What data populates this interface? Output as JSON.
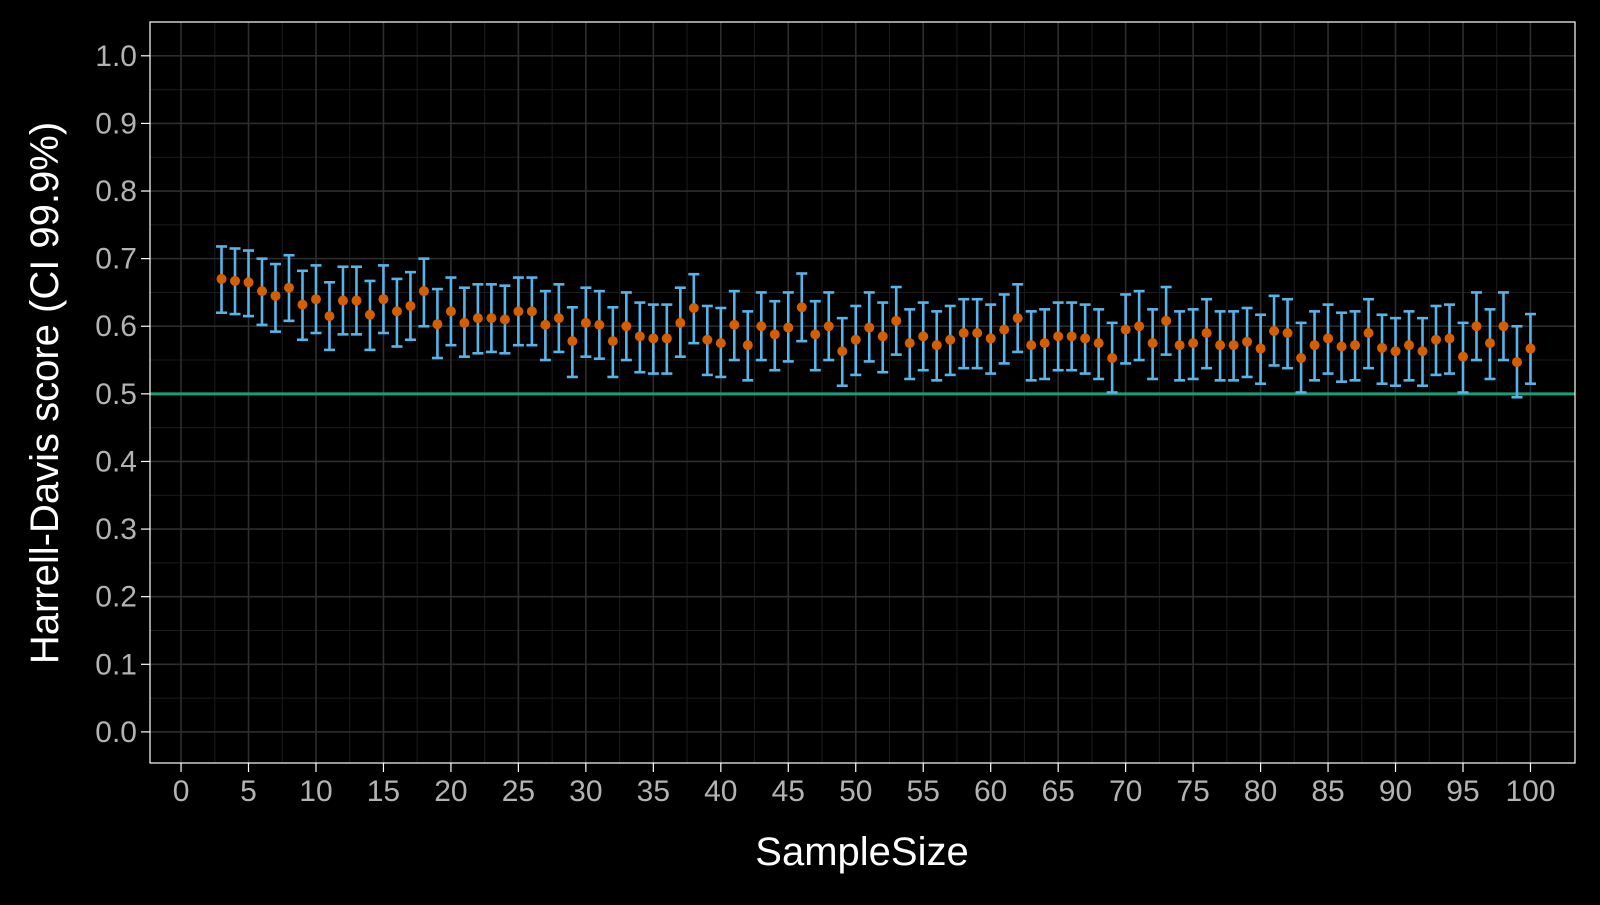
{
  "chart_data": {
    "type": "scatter",
    "xlabel": "SampleSize",
    "ylabel": "Harrell-Davis score (CI 99.9%)",
    "xlim": [
      -2.3,
      103.3
    ],
    "ylim": [
      -0.046,
      1.05
    ],
    "x_ticks": [
      0,
      5,
      10,
      15,
      20,
      25,
      30,
      35,
      40,
      45,
      50,
      55,
      60,
      65,
      70,
      75,
      80,
      85,
      90,
      95,
      100
    ],
    "x_tick_labels": [
      "0",
      "5",
      "10",
      "15",
      "20",
      "25",
      "30",
      "35",
      "40",
      "45",
      "50",
      "55",
      "60",
      "65",
      "70",
      "75",
      "80",
      "85",
      "90",
      "95",
      "100"
    ],
    "y_ticks": [
      0.0,
      0.1,
      0.2,
      0.3,
      0.4,
      0.5,
      0.6,
      0.7,
      0.8,
      0.9,
      1.0
    ],
    "y_tick_labels": [
      "0.0",
      "0.1",
      "0.2",
      "0.3",
      "0.4",
      "0.5",
      "0.6",
      "0.7",
      "0.8",
      "0.9",
      "1.0"
    ],
    "grid": true,
    "reference_line": {
      "y": 0.5,
      "color": "#1a9e77"
    },
    "colors": {
      "point": "#d55e00",
      "errorbar": "#56b4e9",
      "background": "#000000",
      "axis_text": "#b3b3b3",
      "title_text": "#ffffff"
    },
    "x": [
      3,
      4,
      5,
      6,
      7,
      8,
      9,
      10,
      11,
      12,
      13,
      14,
      15,
      16,
      17,
      18,
      19,
      20,
      21,
      22,
      23,
      24,
      25,
      26,
      27,
      28,
      29,
      30,
      31,
      32,
      33,
      34,
      35,
      36,
      37,
      38,
      39,
      40,
      41,
      42,
      43,
      44,
      45,
      46,
      47,
      48,
      49,
      50,
      51,
      52,
      53,
      54,
      55,
      56,
      57,
      58,
      59,
      60,
      61,
      62,
      63,
      64,
      65,
      66,
      67,
      68,
      69,
      70,
      71,
      72,
      73,
      74,
      75,
      76,
      77,
      78,
      79,
      80,
      81,
      82,
      83,
      84,
      85,
      86,
      87,
      88,
      89,
      90,
      91,
      92,
      93,
      94,
      95,
      96,
      97,
      98,
      99,
      100
    ],
    "y": [
      0.67,
      0.667,
      0.665,
      0.652,
      0.645,
      0.657,
      0.632,
      0.64,
      0.615,
      0.638,
      0.638,
      0.617,
      0.64,
      0.622,
      0.63,
      0.652,
      0.603,
      0.622,
      0.605,
      0.612,
      0.612,
      0.61,
      0.622,
      0.622,
      0.602,
      0.612,
      0.578,
      0.605,
      0.602,
      0.578,
      0.6,
      0.585,
      0.582,
      0.582,
      0.605,
      0.627,
      0.58,
      0.575,
      0.602,
      0.572,
      0.6,
      0.588,
      0.598,
      0.628,
      0.588,
      0.6,
      0.563,
      0.58,
      0.598,
      0.585,
      0.608,
      0.575,
      0.585,
      0.572,
      0.58,
      0.59,
      0.59,
      0.582,
      0.595,
      0.612,
      0.572,
      0.575,
      0.585,
      0.585,
      0.582,
      0.575,
      0.553,
      0.595,
      0.6,
      0.575,
      0.608,
      0.572,
      0.575,
      0.59,
      0.572,
      0.572,
      0.577,
      0.567,
      0.593,
      0.59,
      0.553,
      0.572,
      0.582,
      0.57,
      0.572,
      0.59,
      0.568,
      0.563,
      0.572,
      0.563,
      0.58,
      0.582,
      0.555,
      0.6,
      0.575,
      0.6,
      0.547,
      0.567
    ],
    "y_lower": [
      0.62,
      0.618,
      0.615,
      0.602,
      0.592,
      0.608,
      0.58,
      0.59,
      0.565,
      0.588,
      0.588,
      0.565,
      0.59,
      0.57,
      0.58,
      0.6,
      0.553,
      0.572,
      0.555,
      0.56,
      0.562,
      0.56,
      0.572,
      0.572,
      0.55,
      0.562,
      0.525,
      0.555,
      0.552,
      0.525,
      0.55,
      0.532,
      0.53,
      0.53,
      0.555,
      0.575,
      0.528,
      0.525,
      0.55,
      0.52,
      0.55,
      0.535,
      0.548,
      0.578,
      0.535,
      0.55,
      0.512,
      0.528,
      0.548,
      0.532,
      0.558,
      0.522,
      0.535,
      0.52,
      0.528,
      0.538,
      0.538,
      0.53,
      0.545,
      0.562,
      0.52,
      0.522,
      0.535,
      0.535,
      0.53,
      0.522,
      0.502,
      0.545,
      0.55,
      0.522,
      0.558,
      0.52,
      0.522,
      0.538,
      0.52,
      0.52,
      0.525,
      0.515,
      0.542,
      0.538,
      0.502,
      0.52,
      0.53,
      0.518,
      0.52,
      0.538,
      0.515,
      0.512,
      0.52,
      0.512,
      0.528,
      0.53,
      0.502,
      0.55,
      0.522,
      0.55,
      0.495,
      0.515
    ],
    "y_upper": [
      0.718,
      0.715,
      0.712,
      0.7,
      0.692,
      0.705,
      0.682,
      0.69,
      0.665,
      0.688,
      0.688,
      0.667,
      0.69,
      0.67,
      0.68,
      0.7,
      0.655,
      0.672,
      0.657,
      0.662,
      0.662,
      0.66,
      0.672,
      0.672,
      0.652,
      0.662,
      0.628,
      0.657,
      0.652,
      0.628,
      0.65,
      0.635,
      0.632,
      0.632,
      0.657,
      0.677,
      0.63,
      0.627,
      0.652,
      0.622,
      0.65,
      0.637,
      0.65,
      0.678,
      0.637,
      0.65,
      0.612,
      0.63,
      0.65,
      0.635,
      0.658,
      0.625,
      0.635,
      0.622,
      0.63,
      0.64,
      0.64,
      0.632,
      0.647,
      0.662,
      0.622,
      0.625,
      0.635,
      0.635,
      0.632,
      0.625,
      0.605,
      0.647,
      0.652,
      0.625,
      0.658,
      0.622,
      0.625,
      0.64,
      0.622,
      0.622,
      0.627,
      0.617,
      0.645,
      0.64,
      0.605,
      0.622,
      0.632,
      0.62,
      0.622,
      0.64,
      0.617,
      0.612,
      0.622,
      0.612,
      0.63,
      0.632,
      0.605,
      0.65,
      0.625,
      0.65,
      0.6,
      0.618
    ]
  }
}
